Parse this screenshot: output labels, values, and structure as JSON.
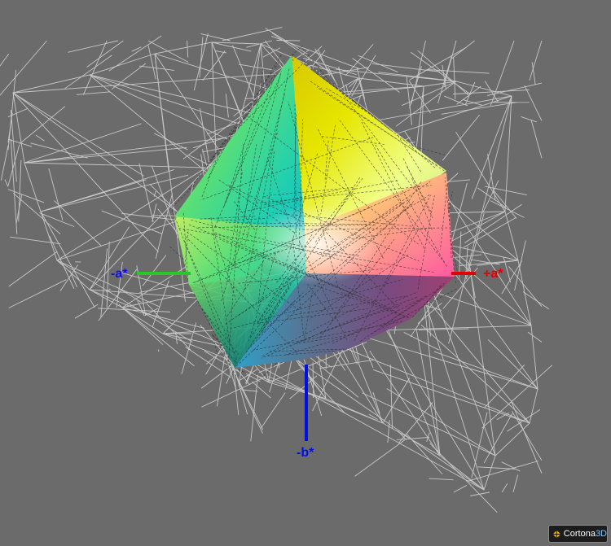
{
  "axes": {
    "neg_a": {
      "label": "-a*",
      "color": "#1a9a1a"
    },
    "pos_a": {
      "label": "+a*",
      "color": "#e00000"
    },
    "neg_b": {
      "label": "-b*",
      "color": "#0010e0"
    }
  },
  "viewer": {
    "brand_main": "Cortona",
    "brand_suffix": "3D",
    "accent_color": "#7ec8ff"
  },
  "colors": {
    "background": "#6b6b6b",
    "wireframe": "#d8d8d8",
    "mesh_lines": "#2a2a2a"
  }
}
